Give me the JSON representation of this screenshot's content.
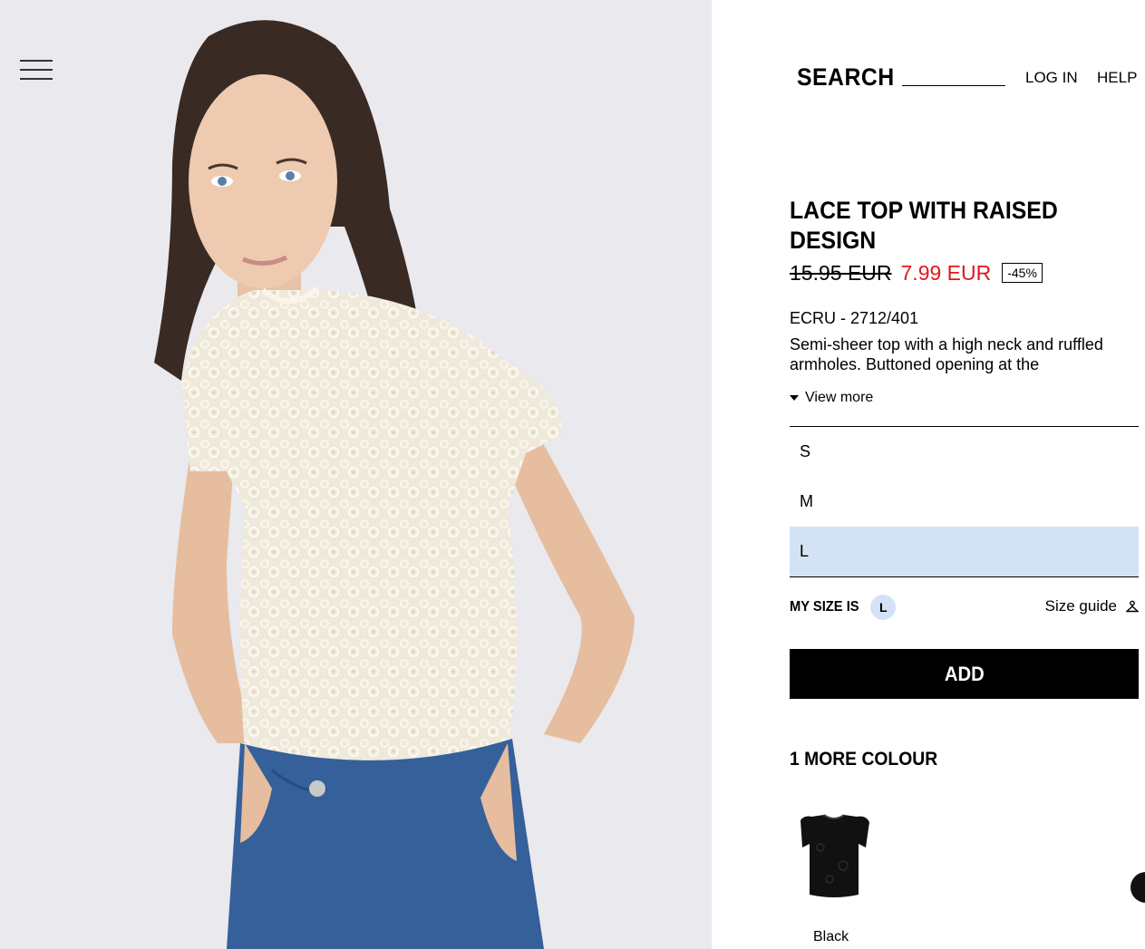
{
  "nav": {
    "menu_icon": "hamburger-icon"
  },
  "header": {
    "search_label": "SEARCH",
    "login_label": "LOG IN",
    "help_label": "HELP"
  },
  "product": {
    "title": "LACE TOP WITH RAISED DESIGN",
    "old_price": "15.95 EUR",
    "new_price": "7.99 EUR",
    "discount": "-45%",
    "reference": "ECRU - 2712/401",
    "description": "Semi-sheer top with a high neck and ruffled armholes. Buttoned opening at the",
    "view_more": "View more",
    "sizes": [
      "S",
      "M",
      "L"
    ],
    "selected_size": "L",
    "my_size_label": "MY SIZE IS",
    "my_size_value": "L",
    "size_guide_label": "Size guide",
    "add_label": "ADD",
    "more_colours_label": "1 MORE COLOUR",
    "colours": [
      {
        "label": "Black"
      }
    ]
  },
  "colors": {
    "price_red": "#e0181b",
    "selected_size_bg": "#d3e3f5",
    "photo_bg": "#e9e9ee"
  }
}
